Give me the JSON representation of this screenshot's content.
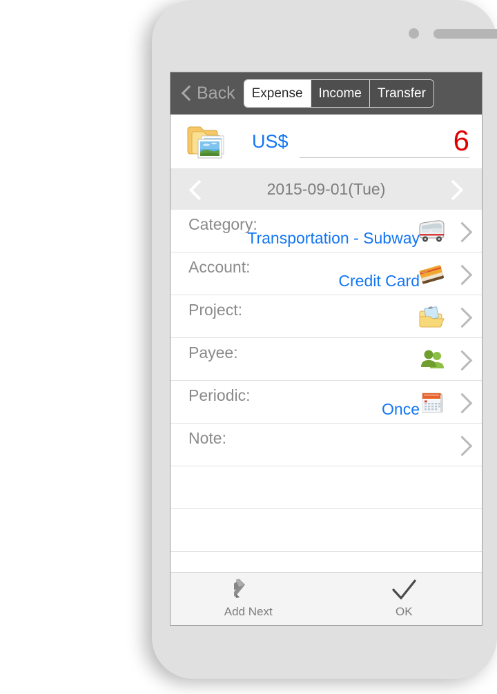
{
  "device": {
    "name": "smartphone-mockup",
    "sensor": "proximity-sensor",
    "speaker": "earpiece-speaker",
    "camera": "front-camera"
  },
  "navbar": {
    "back_label": "Back",
    "back_icon": "chevron-left-icon",
    "segments": [
      {
        "label": "Expense",
        "selected": true
      },
      {
        "label": "Income",
        "selected": false
      },
      {
        "label": "Transfer",
        "selected": false
      }
    ]
  },
  "amount": {
    "attachment_icon": "folder-with-photos-icon",
    "currency": "US$",
    "value": "6",
    "placeholder": "",
    "value_color": "#e00000",
    "currency_color": "#1476f2"
  },
  "date_bar": {
    "prev_icon": "chevron-left-icon",
    "next_icon": "chevron-right-icon",
    "date": "2015-09-01(Tue)"
  },
  "fields": [
    {
      "label": "Category:",
      "value": "Transportation - Subway",
      "icon": "bus-icon",
      "chevron": "chevron-right-icon"
    },
    {
      "label": "Account:",
      "value": "Credit Card",
      "icon": "credit-card-icon",
      "chevron": "chevron-right-icon"
    },
    {
      "label": "Project:",
      "value": "",
      "icon": "project-folder-icon",
      "chevron": "chevron-right-icon"
    },
    {
      "label": "Payee:",
      "value": "",
      "icon": "people-icon",
      "chevron": "chevron-right-icon"
    },
    {
      "label": "Periodic:",
      "value": "Once",
      "icon": "calendar-icon",
      "chevron": "chevron-right-icon"
    },
    {
      "label": "Note:",
      "value": "",
      "icon": "",
      "chevron": "chevron-right-icon"
    },
    {
      "label": "",
      "value": "",
      "icon": "",
      "chevron": ""
    },
    {
      "label": "",
      "value": "",
      "icon": "",
      "chevron": ""
    }
  ],
  "toolbar": {
    "add_next_label": "Add Next",
    "add_next_icon": "pencil-icon",
    "ok_label": "OK",
    "ok_icon": "checkmark-icon"
  },
  "colors": {
    "navbar_bg": "#575757",
    "date_bar_bg": "#e9e9e9",
    "accent_blue": "#1476f2",
    "amount_red": "#e00000",
    "label_gray": "#8a8a8a",
    "toolbar_bg": "#f4f4f4",
    "device_body": "#e0e0e0"
  }
}
